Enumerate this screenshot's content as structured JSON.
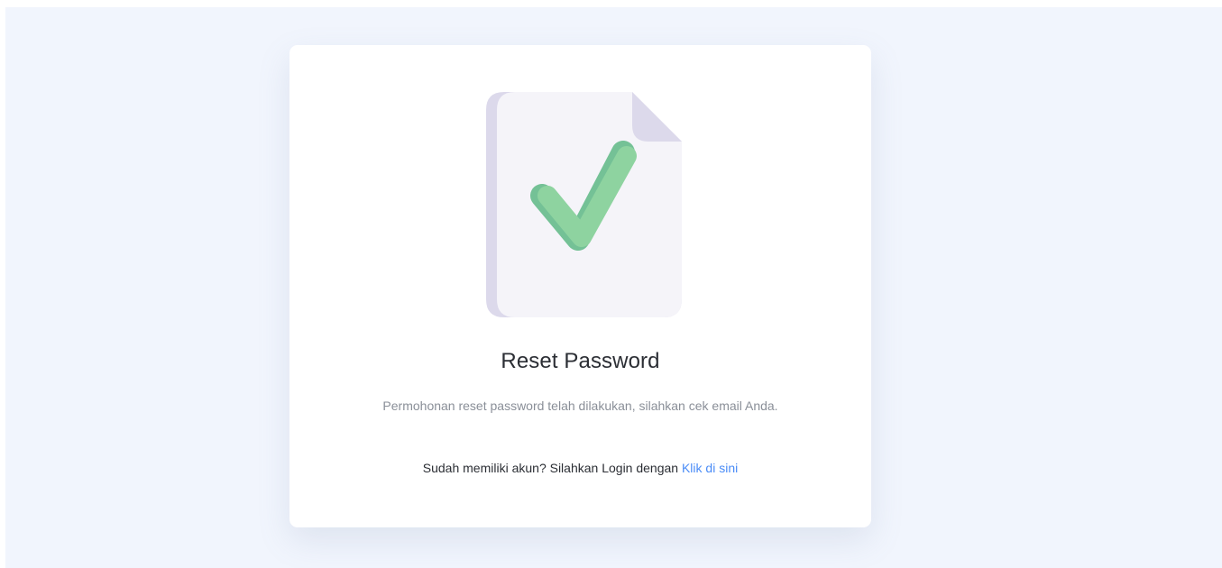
{
  "card": {
    "illustration_icon": "document-check-icon",
    "title": "Reset Password",
    "message": "Permohonan reset password telah dilakukan, silahkan cek email Anda.",
    "login_prompt": "Sudah memiliki akun? Silahkan Login dengan",
    "login_link": "Klik di sini"
  },
  "colors": {
    "page_background": "#f1f5fd",
    "card_background": "#ffffff",
    "link": "#4a8cf7",
    "check": "#8ed3a0"
  }
}
